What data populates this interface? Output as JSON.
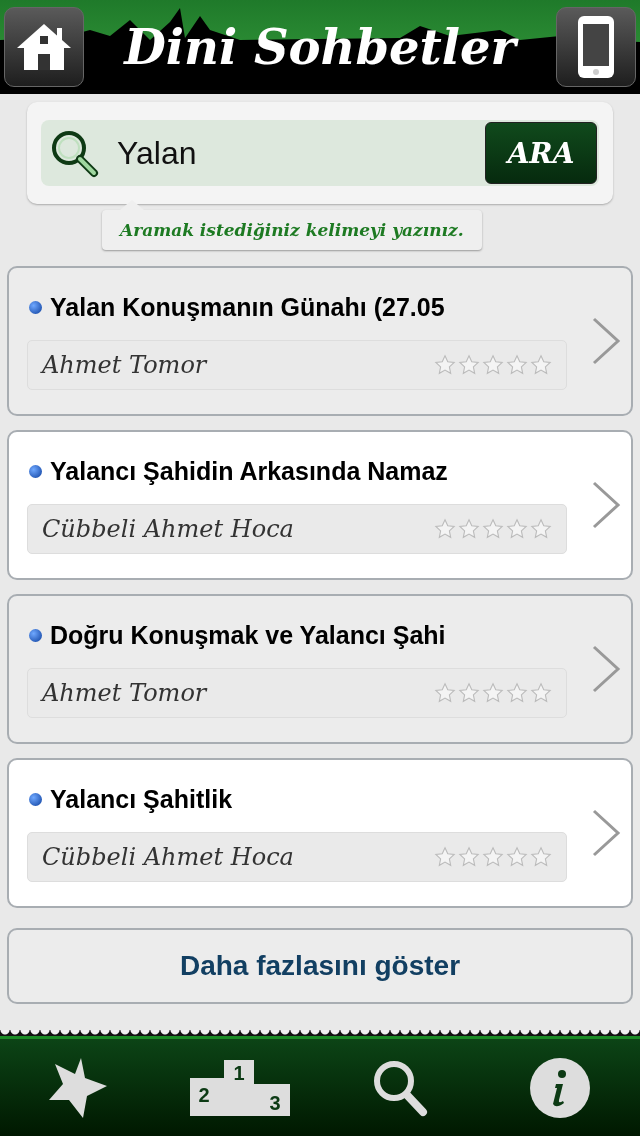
{
  "header": {
    "title": "Dini Sohbetler"
  },
  "search": {
    "value": "Yalan",
    "button": "ARA",
    "hint": "Aramak istediğiniz kelimeyi yazınız."
  },
  "results": [
    {
      "title": "Yalan Konuşmanın Günahı (27.05",
      "speaker": "Ahmet Tomor",
      "stars": 0
    },
    {
      "title": "Yalancı Şahidin Arkasında Namaz",
      "speaker": "Cübbeli Ahmet Hoca",
      "stars": 0
    },
    {
      "title": "Doğru Konuşmak ve Yalancı Şahi",
      "speaker": "Ahmet Tomor",
      "stars": 0
    },
    {
      "title": "Yalancı Şahitlik",
      "speaker": "Cübbeli Ahmet Hoca",
      "stars": 0
    }
  ],
  "more_button": "Daha fazlasını göster",
  "tab_bar": {
    "podium_places": [
      "1",
      "2",
      "3"
    ]
  }
}
